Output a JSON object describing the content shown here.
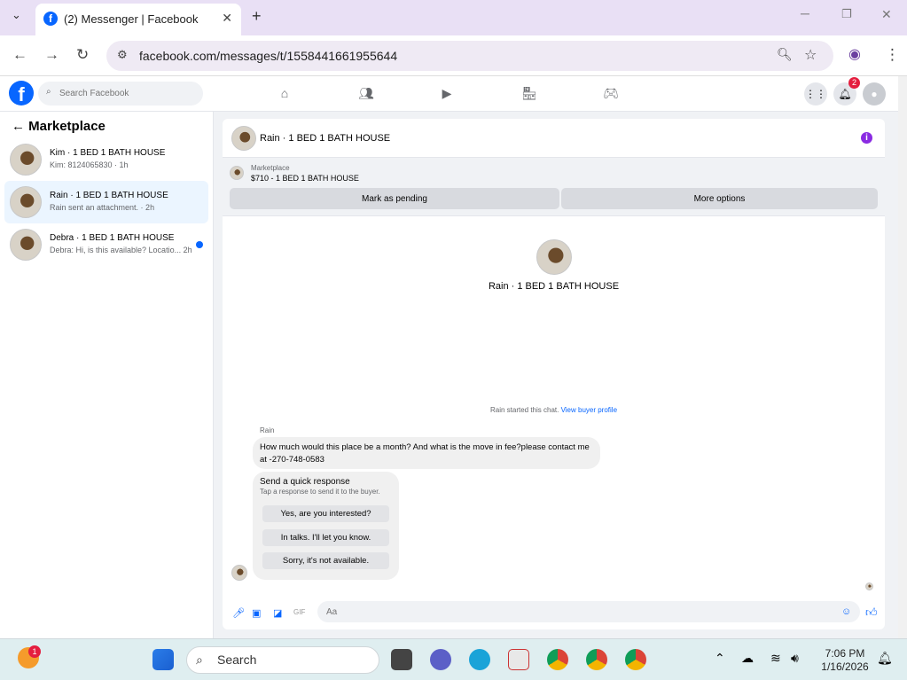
{
  "browser": {
    "tab_title": "(2) Messenger | Facebook",
    "url": "facebook.com/messages/t/1558441661955644"
  },
  "fb": {
    "search_placeholder": "Search Facebook",
    "notification_count": "2"
  },
  "sidebar": {
    "header": "Marketplace",
    "conversations": [
      {
        "name": "Kim · 1 BED 1 BATH HOUSE",
        "snippet": "Kim: 8124065830 · 1h",
        "active": false,
        "unread": false
      },
      {
        "name": "Rain · 1 BED 1 BATH HOUSE",
        "snippet": "Rain sent an attachment. · 2h",
        "active": true,
        "unread": false
      },
      {
        "name": "Debra · 1 BED 1 BATH HOUSE",
        "snippet": "Debra: Hi, is this available? Locatio...   2h",
        "active": false,
        "unread": true
      }
    ]
  },
  "chat": {
    "header_name": "Rain · 1 BED 1 BATH HOUSE",
    "marketplace_label": "Marketplace",
    "listing": "$710 - 1 BED 1 BATH HOUSE",
    "mark_pending": "Mark as pending",
    "more_options": "More options",
    "center_name": "Rain · 1 BED 1 BATH HOUSE",
    "started_text": "Rain started this chat.",
    "view_profile": "View buyer profile",
    "sender": "Rain",
    "message": "How much would this place be a month? And what is the move in fee?please contact me at -270-748-0583",
    "quick_title": "Send a quick response",
    "quick_sub": "Tap a response to send it to the buyer.",
    "quick_replies": [
      "Yes, are you interested?",
      "In talks. I'll let you know.",
      "Sorry, it's not available."
    ],
    "composer_placeholder": "Aa"
  },
  "taskbar": {
    "search": "Search",
    "time": "7:06 PM",
    "date": "1/16/2026",
    "weather_badge": "1"
  },
  "colors": {
    "fb_blue": "#0866ff",
    "active_conv": "#ebf5ff",
    "badge_red": "#e41e3f"
  }
}
